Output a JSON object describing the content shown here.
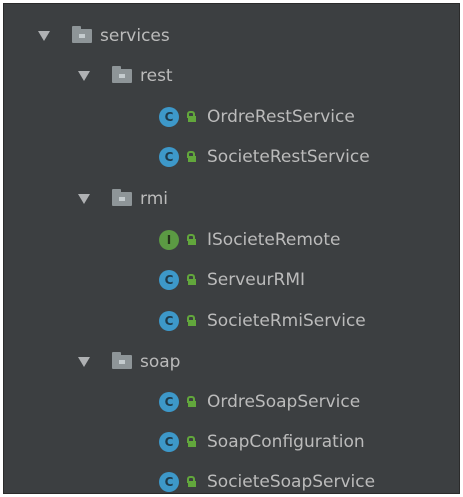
{
  "tree": {
    "root": {
      "label": "services",
      "icon": "folder-icon"
    },
    "packages": [
      {
        "label": "rest",
        "icon": "folder-icon",
        "items": [
          {
            "label": "OrdreRestService",
            "kind": "class",
            "badge": "C"
          },
          {
            "label": "SocieteRestService",
            "kind": "class",
            "badge": "C"
          }
        ]
      },
      {
        "label": "rmi",
        "icon": "folder-icon",
        "items": [
          {
            "label": "ISocieteRemote",
            "kind": "interface",
            "badge": "I"
          },
          {
            "label": "ServeurRMI",
            "kind": "class",
            "badge": "C"
          },
          {
            "label": "SocieteRmiService",
            "kind": "class",
            "badge": "C"
          }
        ]
      },
      {
        "label": "soap",
        "icon": "folder-icon",
        "items": [
          {
            "label": "OrdreSoapService",
            "kind": "class",
            "badge": "C"
          },
          {
            "label": "SoapConfiguration",
            "kind": "class",
            "badge": "C"
          },
          {
            "label": "SocieteSoapService",
            "kind": "class",
            "badge": "C"
          }
        ]
      }
    ]
  },
  "colors": {
    "background": "#3c3f41",
    "text": "#bbbbbb",
    "class_badge": "#3d98c9",
    "interface_badge": "#5b9a43",
    "access_lock": "#62a73c",
    "folder": "#8e9598"
  }
}
